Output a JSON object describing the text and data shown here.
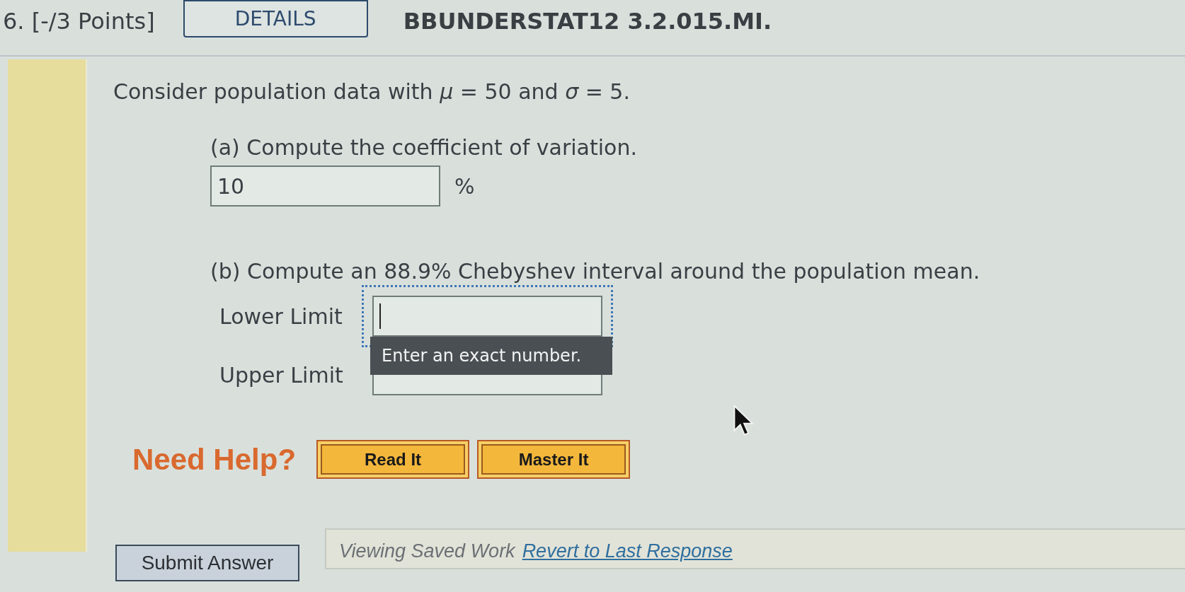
{
  "header": {
    "question_number": "6. [-/3 Points]",
    "details_button": "DETAILS",
    "problem_id": "BBUNDERSTAT12 3.2.015.MI."
  },
  "question": {
    "prompt": "Consider population data with *μ* = 50 and *σ* = 5.",
    "parts": [
      {
        "label": "(a) Compute the coefficient of variation.",
        "fields": [
          {
            "value": "10",
            "unit": "%",
            "focused": false
          }
        ]
      },
      {
        "label": "(b) Compute an 88.9% Chebyshev interval around the population mean.",
        "fields": [
          {
            "label": "Lower Limit",
            "focused": true,
            "tooltip": "Enter an exact number."
          },
          {
            "label": "Upper Limit",
            "focused": false
          }
        ]
      }
    ]
  },
  "help": {
    "label": "Need Help?",
    "buttons": [
      "Read It",
      "Master It"
    ]
  },
  "footer": {
    "submit_button": "Submit Answer",
    "status": "Viewing Saved Work",
    "link": "Revert to Last Response"
  }
}
